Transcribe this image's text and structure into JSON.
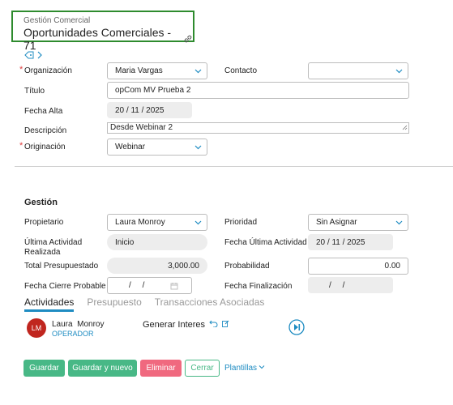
{
  "header": {
    "subtitle": "Gestión Comercial",
    "title": "Oportunidades Comerciales - 71"
  },
  "form": {
    "organizacion": {
      "label": "Organización",
      "value": "Maria Vargas"
    },
    "contacto": {
      "label": "Contacto",
      "value": ""
    },
    "titulo": {
      "label": "Título",
      "value": "opCom MV Prueba 2"
    },
    "fecha_alta": {
      "label": "Fecha Alta",
      "value": "20 / 11 / 2025"
    },
    "descripcion": {
      "label": "Descripción",
      "value": "Desde Webinar 2"
    },
    "originacion": {
      "label": "Originación",
      "value": "Webinar"
    }
  },
  "gestion": {
    "title": "Gestión",
    "propietario": {
      "label": "Propietario",
      "value": "Laura Monroy"
    },
    "prioridad": {
      "label": "Prioridad",
      "value": "Sin Asignar"
    },
    "ultima_actividad_realizada": {
      "label_line1": "Última Actividad",
      "label_line2": "Realizada",
      "value": "Inicio"
    },
    "fecha_ultima_actividad": {
      "label": "Fecha Última Actividad",
      "value": "20 / 11 / 2025"
    },
    "total_presupuestado": {
      "label": "Total Presupuestado",
      "value": "3,000.00"
    },
    "probabilidad": {
      "label": "Probabilidad",
      "value": "0.00"
    },
    "fecha_cierre_probable": {
      "label": "Fecha Cierre Probable",
      "value": "/     /"
    },
    "fecha_finalizacion": {
      "label": "Fecha Finalización",
      "value": "/     /"
    }
  },
  "tabs": [
    {
      "label": "Actividades",
      "active": true
    },
    {
      "label": "Presupuesto",
      "active": false
    },
    {
      "label": "Transacciones Asociadas",
      "active": false
    }
  ],
  "activity": {
    "avatar_initials": "LM",
    "user_name": "Laura  Monroy",
    "user_role": "OPERADOR",
    "title": "Generar Interes"
  },
  "buttons": {
    "guardar": "Guardar",
    "guardar_nuevo": "Guardar y nuevo",
    "eliminar": "Eliminar",
    "cerrar": "Cerrar",
    "plantillas": "Plantillas"
  },
  "colors": {
    "header_border": "#2e8b2e",
    "accent_blue": "#1f8cc2",
    "green": "#48b886",
    "red": "#f0697f",
    "avatar": "#c0261f"
  },
  "icons": [
    "link-icon",
    "tag-icon",
    "chevron-down-icon",
    "calendar-icon",
    "undo-icon",
    "edit-icon",
    "next-icon",
    "resize-icon"
  ]
}
